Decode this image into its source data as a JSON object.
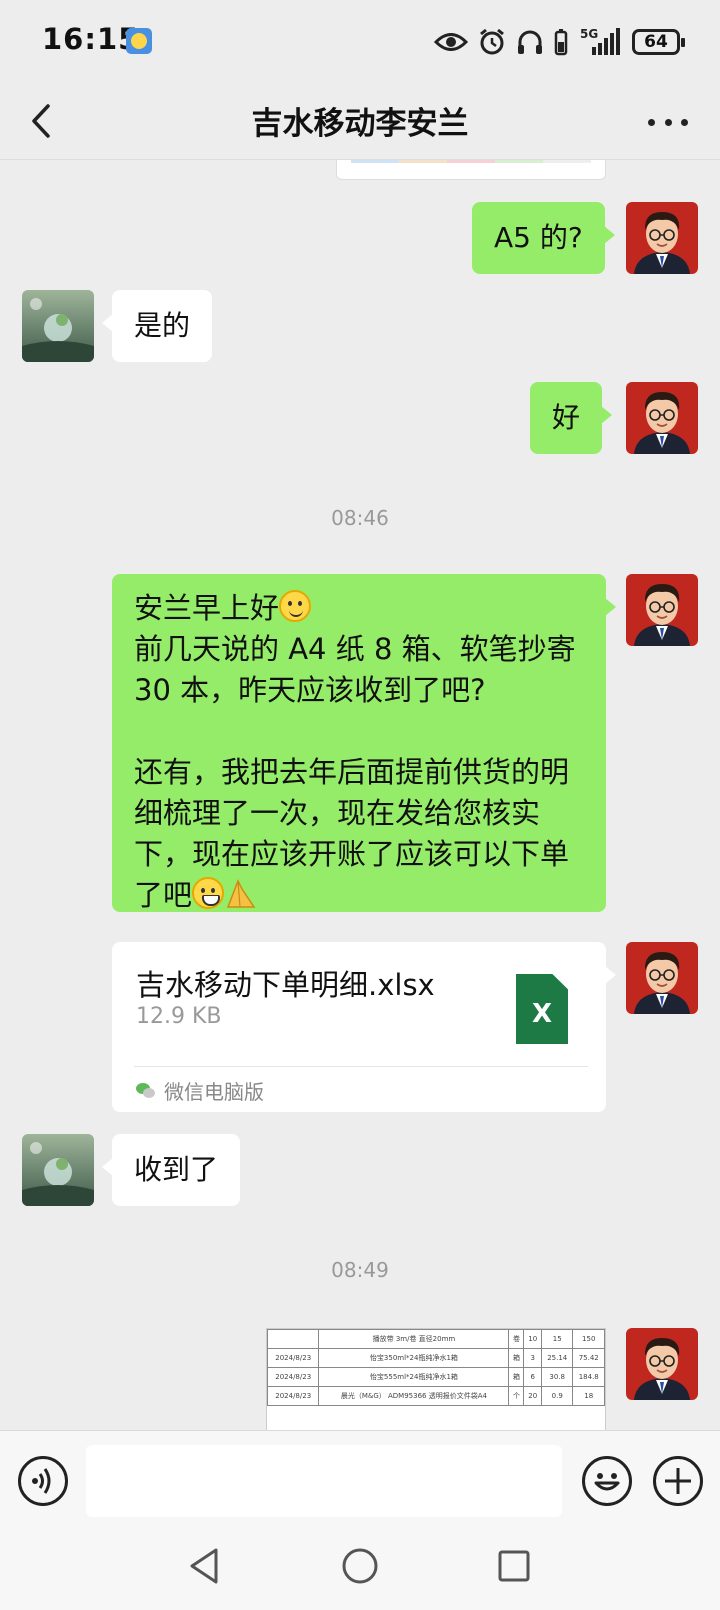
{
  "status_bar": {
    "time": "16:15",
    "network": "5G",
    "battery": "64",
    "icons": [
      "weather-icon",
      "eye-icon",
      "alarm-icon",
      "headphones-icon",
      "battery-small-icon",
      "signal-icon",
      "battery-icon"
    ]
  },
  "header": {
    "title": "吉水移动李安兰",
    "back_icon": "chevron-left-icon",
    "more_icon": "more-dots-icon"
  },
  "messages": {
    "m1": "A5 的?",
    "m2": "是的",
    "m3": "好",
    "time1": "08:46",
    "m4_lines": [
      "安兰早上好",
      "前几天说的 A4 纸 8 箱、软笔抄寄",
      "30 本，昨天应该收到了吧?",
      "",
      "还有，我把去年后面提前供货的明",
      "细梳理了一次，现在发给您核实",
      "下，现在应该开账了应该可以下单",
      "了吧"
    ],
    "file": {
      "name": "吉水移动下单明细.xlsx",
      "size": "12.9 KB",
      "icon_letter": "X",
      "source": "微信电脑版"
    },
    "m5": "收到了",
    "time2": "08:49",
    "image_rows": [
      [
        "",
        "播放带 3m/卷 直径20mm",
        "卷",
        "10",
        "15",
        "150"
      ],
      [
        "2024/8/23",
        "怡宝350ml*24瓶纯净水1箱",
        "箱",
        "3",
        "25.14",
        "75.42"
      ],
      [
        "2024/8/23",
        "怡宝555ml*24瓶纯净水1箱",
        "箱",
        "6",
        "30.8",
        "184.8"
      ],
      [
        "2024/8/23",
        "晨光（M&G） ADM95366 透明报价文件袋A4",
        "个",
        "20",
        "0.9",
        "18"
      ]
    ]
  },
  "input_bar": {
    "placeholder": "",
    "icons": [
      "voice-icon",
      "emoji-icon",
      "plus-icon"
    ]
  },
  "system_nav": {
    "icons": [
      "back-triangle-icon",
      "home-circle-icon",
      "recents-square-icon"
    ]
  }
}
